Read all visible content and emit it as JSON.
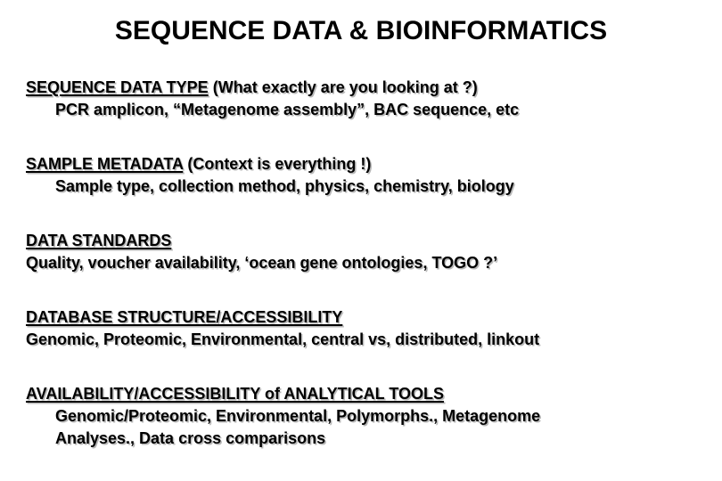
{
  "slide": {
    "title": "SEQUENCE DATA & BIOINFORMATICS",
    "background_color": "#ffffff",
    "text_color": "#000000",
    "shadow_color": "#b8b8b8",
    "sections": [
      {
        "id": "sequence-data-type",
        "heading": "SEQUENCE DATA TYPE",
        "heading_tail": "  (What exactly are you looking at ?)",
        "body": [
          "PCR amplicon,  “Metagenome assembly”, BAC sequence, etc"
        ],
        "body_indented": true
      },
      {
        "id": "sample-metadata",
        "heading": "SAMPLE METADATA",
        "heading_tail": "  (Context is everything !)",
        "body": [
          "Sample type, collection method, physics, chemistry, biology"
        ],
        "body_indented": true
      },
      {
        "id": "data-standards",
        "heading": "DATA STANDARDS",
        "heading_tail": "",
        "body": [
          "Quality, voucher availability,  ‘ocean gene ontologies, TOGO ?’"
        ],
        "body_indented": false
      },
      {
        "id": "database-structure",
        "heading": "DATABASE STRUCTURE/ACCESSIBILITY",
        "heading_tail": "",
        "body": [
          "Genomic, Proteomic, Environmental, central vs, distributed, linkout"
        ],
        "body_indented": false
      },
      {
        "id": "analytical-tools",
        "heading": "AVAILABILITY/ACCESSIBILITY of ANALYTICAL TOOLS",
        "heading_tail": "",
        "body": [
          "Genomic/Proteomic, Environmental, Polymorphs., Metagenome",
          "Analyses., Data cross comparisons"
        ],
        "body_indented": true
      }
    ]
  }
}
